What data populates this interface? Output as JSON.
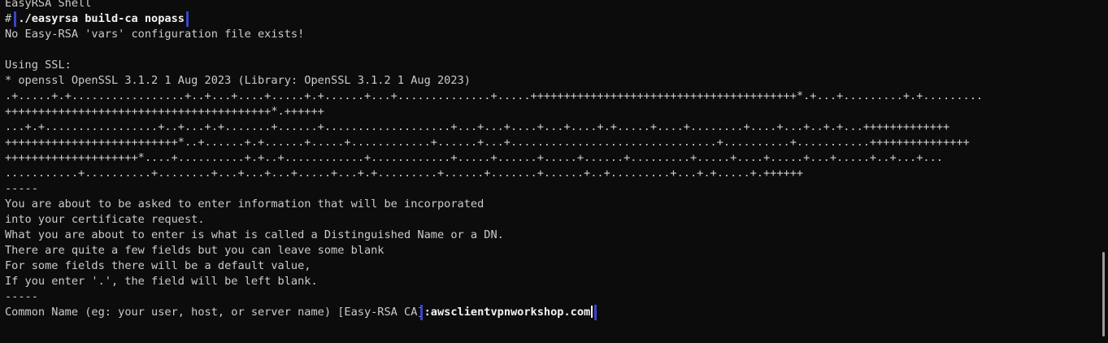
{
  "window": {
    "title": "EasyRSA Shell"
  },
  "command": {
    "prompt": "# ",
    "text": "./easyrsa build-ca nopass"
  },
  "output": {
    "vars_notice": "No Easy-RSA 'vars' configuration file exists!",
    "blank": "",
    "ssl_heading": "Using SSL:",
    "ssl_version": "* openssl OpenSSL 3.1.2 1 Aug 2023 (Library: OpenSSL 3.1.2 1 Aug 2023)",
    "keygen_lines": [
      ".+.....+.+.................+..+...+....+.....+.+......+...+..............+.....++++++++++++++++++++++++++++++++++++++++*.+...+.........+.+.........",
      "++++++++++++++++++++++++++++++++++++++++*.++++++",
      "...+.+.................+..+...+.+.......+......+...................+...+...+....+...+....+.+.....+....+........+....+...+..+.+...+++++++++++++",
      "++++++++++++++++++++++++++*..+......+.+......+.....+............+......+...+...............................+..........+...........+++++++++++++++",
      "++++++++++++++++++++*....+..........+.+..+............+............+.....+......+.....+......+.........+.....+....+.....+...+.....+..+...+...",
      "...........+..........+........+...+...+...+.....+...+.+.........+......+.......+......+..+.........+...+.+.....+.++++++"
    ],
    "separator_1": "-----",
    "info_lines": [
      "You are about to be asked to enter information that will be incorporated",
      "into your certificate request.",
      "What you are about to enter is what is called a Distinguished Name or a DN.",
      "There are quite a few fields but you can leave some blank",
      "For some fields there will be a default value,",
      "If you enter '.', the field will be left blank."
    ],
    "separator_2": "-----",
    "cn_prompt": "Common Name (eg: your user, host, or server name) [Easy-RSA CA]",
    "cn_input": ":awsclientvpnworkshop.com"
  },
  "colors": {
    "background": "#0c0c0c",
    "foreground": "#cccccc",
    "highlight_box": "#3a44c6"
  }
}
